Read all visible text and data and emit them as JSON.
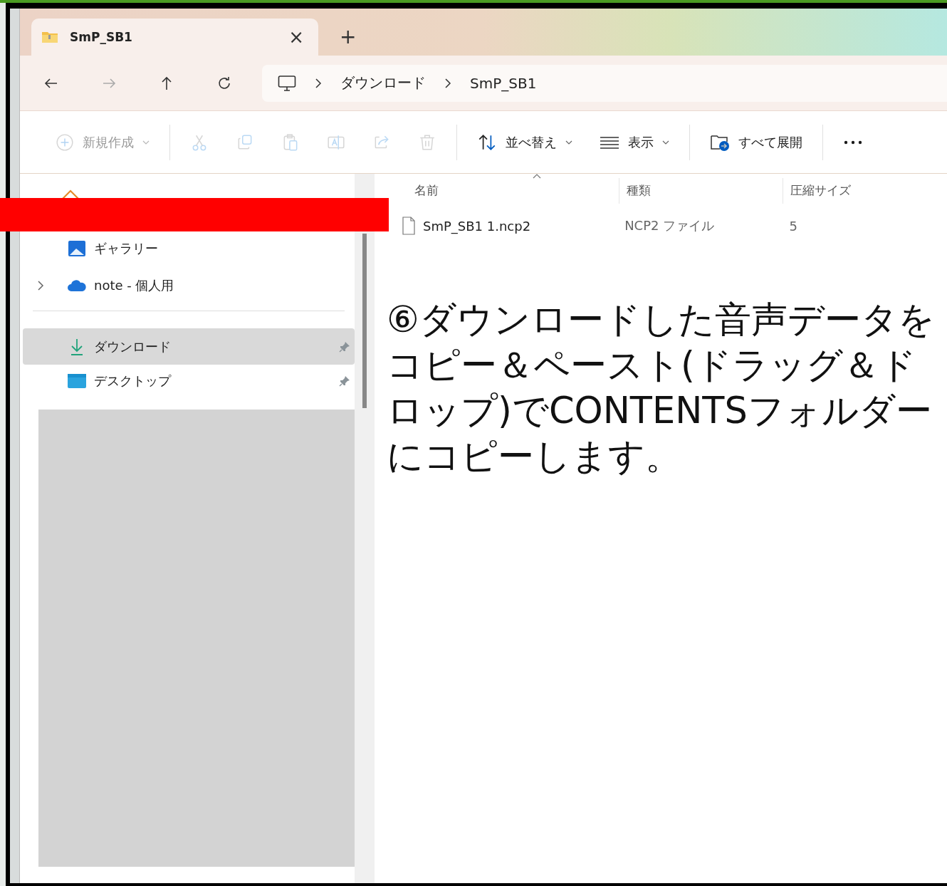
{
  "tab": {
    "title": "SmP_SB1",
    "close": "×",
    "new": "+"
  },
  "breadcrumbs": [
    {
      "label": "ダウンロード"
    },
    {
      "label": "SmP_SB1"
    }
  ],
  "toolbar": [
    {
      "kind": "new",
      "label": "新規作成",
      "disabled": true
    },
    {
      "kind": "cut",
      "disabled": true
    },
    {
      "kind": "copy",
      "disabled": true
    },
    {
      "kind": "paste",
      "disabled": true
    },
    {
      "kind": "rename",
      "disabled": true
    },
    {
      "kind": "share",
      "disabled": true
    },
    {
      "kind": "delete",
      "disabled": true
    },
    {
      "kind": "sort",
      "label": "並べ替え",
      "disabled": false
    },
    {
      "kind": "view",
      "label": "表示",
      "disabled": false
    },
    {
      "kind": "extract",
      "label": "すべて展開",
      "disabled": false
    },
    {
      "kind": "more"
    }
  ],
  "sidebar": {
    "items": [
      {
        "label": "ギャラリー",
        "selected": false,
        "pinned": false,
        "expandable": false
      },
      {
        "label": "note - 個人用",
        "selected": false,
        "pinned": false,
        "expandable": true
      },
      {
        "kind": "divider"
      },
      {
        "label": "ダウンロード",
        "selected": true,
        "pinned": true,
        "expandable": false
      },
      {
        "label": "デスクトップ",
        "selected": false,
        "pinned": true,
        "expandable": false
      }
    ]
  },
  "table": {
    "columns": [
      "名前",
      "種類",
      "圧縮サイズ"
    ],
    "rows": [
      {
        "cells": [
          "SmP_SB1 1.ncp2",
          "NCP2 ファイル",
          "5"
        ]
      }
    ]
  },
  "annotation": "⑥ダウンロードした音声データをコピー＆ペースト(ドラッグ＆ドロップ)でCONTENTSフォルダーにコピーします。"
}
